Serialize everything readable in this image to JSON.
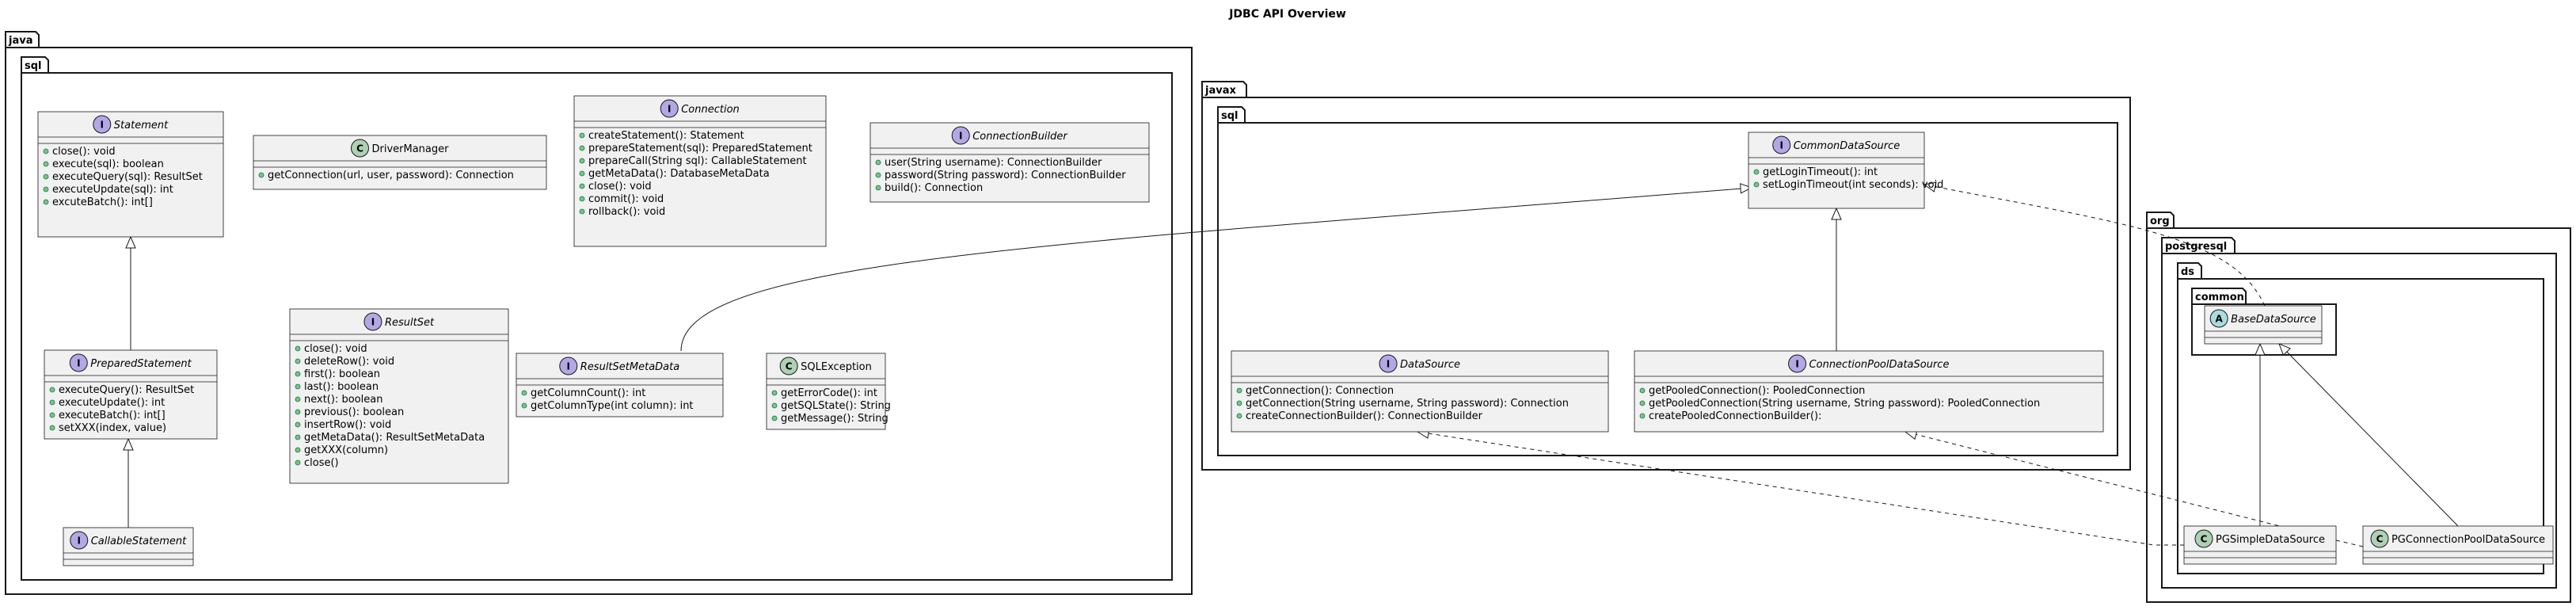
{
  "diagram": {
    "title": "JDBC API Overview",
    "packages": {
      "java": "java",
      "java_sql": "sql",
      "javax": "javax",
      "javax_sql": "sql",
      "org": "org",
      "postgresql": "postgresql",
      "ds": "ds",
      "common": "common"
    },
    "stereotype_letters": {
      "interface": "I",
      "class": "C",
      "abstract": "A"
    },
    "classes": {
      "statement": {
        "name": "Statement",
        "kind": "interface",
        "members": [
          "close(): void",
          "execute(sql): boolean",
          "executeQuery(sql): ResultSet",
          "executeUpdate(sql): int",
          "excuteBatch(): int[]"
        ]
      },
      "driver_manager": {
        "name": "DriverManager",
        "kind": "class",
        "members": [
          "getConnection(url, user, password): Connection"
        ]
      },
      "connection": {
        "name": "Connection",
        "kind": "interface",
        "members": [
          "createStatement(): Statement",
          "prepareStatement(sql): PreparedStatement",
          "prepareCall(String sql): CallableStatement",
          "getMetaData(): DatabaseMetaData",
          "close(): void",
          "commit(): void",
          "rollback(): void"
        ]
      },
      "connection_builder": {
        "name": "ConnectionBuilder",
        "kind": "interface",
        "members": [
          "user(String username): ConnectionBuilder",
          "password(String password): ConnectionBuilder",
          "build(): Connection"
        ]
      },
      "prepared_statement": {
        "name": "PreparedStatement",
        "kind": "interface",
        "members": [
          "executeQuery(): ResultSet",
          "executeUpdate(): int",
          "executeBatch(): int[]",
          "setXXX(index, value)"
        ]
      },
      "result_set": {
        "name": "ResultSet",
        "kind": "interface",
        "members": [
          "close(): void",
          "deleteRow(): void",
          "first(): boolean",
          "last(): boolean",
          "next(): boolean",
          "previous(): boolean",
          "insertRow(): void",
          "getMetaData(): ResultSetMetaData",
          "getXXX(column)",
          "close()"
        ]
      },
      "result_set_meta_data": {
        "name": "ResultSetMetaData",
        "kind": "interface",
        "members": [
          "getColumnCount(): int",
          "getColumnType(int column): int"
        ]
      },
      "sql_exception": {
        "name": "SQLException",
        "kind": "class",
        "members": [
          "getErrorCode(): int",
          "getSQLState(): String",
          "getMessage(): String"
        ]
      },
      "callable_statement": {
        "name": "CallableStatement",
        "kind": "interface",
        "members": []
      },
      "common_data_source": {
        "name": "CommonDataSource",
        "kind": "interface",
        "members": [
          "getLoginTimeout(): int",
          "setLoginTimeout(int seconds): void"
        ]
      },
      "data_source": {
        "name": "DataSource",
        "kind": "interface",
        "members": [
          "getConnection(): Connection",
          "getConnection(String username, String password): Connection",
          "createConnectionBuilder(): ConnectionBuilder"
        ]
      },
      "connection_pool_data_source": {
        "name": "ConnectionPoolDataSource",
        "kind": "interface",
        "members": [
          "getPooledConnection(): PooledConnection",
          "getPooledConnection(String username, String password): PooledConnection",
          "createPooledConnectionBuilder():"
        ]
      },
      "base_data_source": {
        "name": "BaseDataSource",
        "kind": "abstract",
        "members": []
      },
      "pg_simple_data_source": {
        "name": "PGSimpleDataSource",
        "kind": "class",
        "members": []
      },
      "pg_connection_pool_data_source": {
        "name": "PGConnectionPoolDataSource",
        "kind": "class",
        "members": []
      }
    },
    "relations": [
      {
        "from": "prepared_statement",
        "to": "statement",
        "type": "extends"
      },
      {
        "from": "callable_statement",
        "to": "prepared_statement",
        "type": "extends"
      },
      {
        "from": "data_source",
        "to": "common_data_source",
        "type": "extends"
      },
      {
        "from": "connection_pool_data_source",
        "to": "common_data_source",
        "type": "extends"
      },
      {
        "from": "base_data_source",
        "to": "common_data_source",
        "type": "implements"
      },
      {
        "from": "pg_simple_data_source",
        "to": "base_data_source",
        "type": "extends"
      },
      {
        "from": "pg_connection_pool_data_source",
        "to": "base_data_source",
        "type": "extends"
      },
      {
        "from": "pg_simple_data_source",
        "to": "data_source",
        "type": "implements"
      },
      {
        "from": "pg_connection_pool_data_source",
        "to": "connection_pool_data_source",
        "type": "implements"
      }
    ],
    "colors": {
      "class_fill": "#F1F1F1",
      "border": "#181818",
      "interface_circle": "#B4A7E5",
      "class_circle": "#ADD1B2",
      "abstract_circle": "#A9DCDF",
      "visibility": "#84BE84"
    }
  }
}
